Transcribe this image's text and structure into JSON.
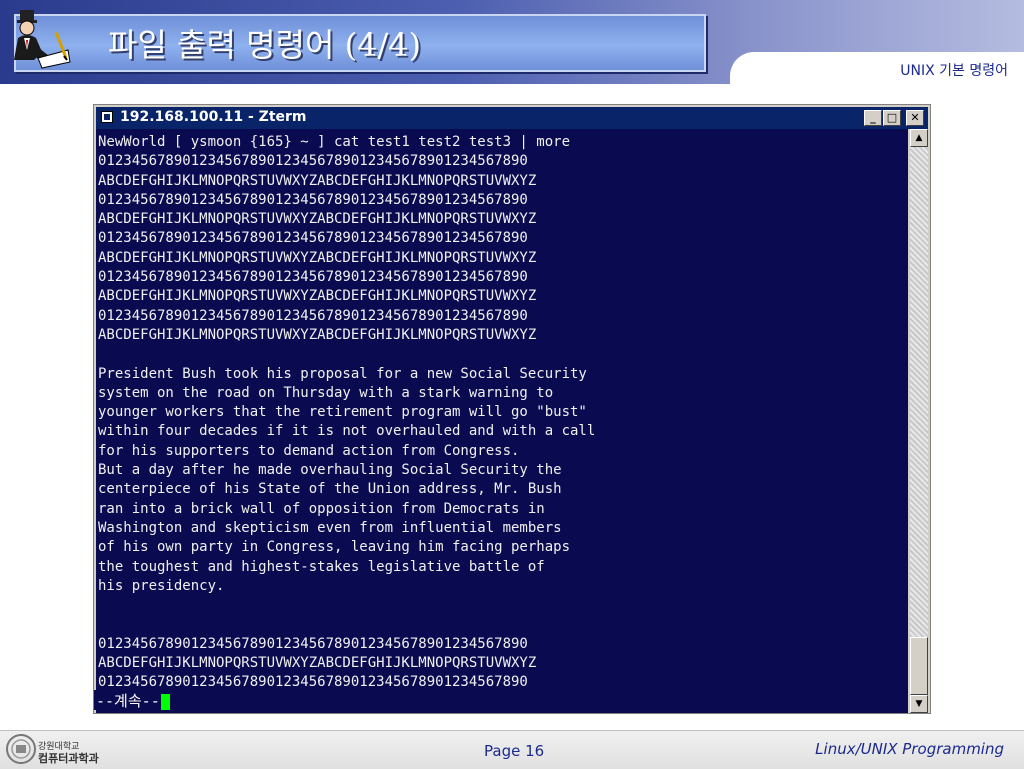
{
  "slide": {
    "title": "파일 출력 명령어 (4/4)",
    "subtitle": "UNIX 기본 명령어"
  },
  "window": {
    "title": "192.168.100.11 - Zterm",
    "minimize_label": "_",
    "maximize_label": "□",
    "close_label": "✕"
  },
  "terminal": {
    "lines": [
      "NewWorld [ ysmoon {165} ~ ] cat test1 test2 test3 | more",
      "012345678901234567890123456789012345678901234567890",
      "ABCDEFGHIJKLMNOPQRSTUVWXYZABCDEFGHIJKLMNOPQRSTUVWXYZ",
      "012345678901234567890123456789012345678901234567890",
      "ABCDEFGHIJKLMNOPQRSTUVWXYZABCDEFGHIJKLMNOPQRSTUVWXYZ",
      "012345678901234567890123456789012345678901234567890",
      "ABCDEFGHIJKLMNOPQRSTUVWXYZABCDEFGHIJKLMNOPQRSTUVWXYZ",
      "012345678901234567890123456789012345678901234567890",
      "ABCDEFGHIJKLMNOPQRSTUVWXYZABCDEFGHIJKLMNOPQRSTUVWXYZ",
      "012345678901234567890123456789012345678901234567890",
      "ABCDEFGHIJKLMNOPQRSTUVWXYZABCDEFGHIJKLMNOPQRSTUVWXYZ",
      "",
      "President Bush took his proposal for a new Social Security",
      "system on the road on Thursday with a stark warning to",
      "younger workers that the retirement program will go \"bust\"",
      "within four decades if it is not overhauled and with a call",
      "for his supporters to demand action from Congress.",
      "But a day after he made overhauling Social Security the",
      "centerpiece of his State of the Union address, Mr. Bush",
      "ran into a brick wall of opposition from Democrats in",
      "Washington and skepticism even from influential members",
      "of his own party in Congress, leaving him facing perhaps",
      "the toughest and highest-stakes legislative battle of",
      "his presidency.",
      "",
      "",
      "012345678901234567890123456789012345678901234567890",
      "ABCDEFGHIJKLMNOPQRSTUVWXYZABCDEFGHIJKLMNOPQRSTUVWXYZ",
      "012345678901234567890123456789012345678901234567890"
    ],
    "more_prompt": "--계속--"
  },
  "footer": {
    "university": "강원대학교",
    "department": "컴퓨터과학과",
    "page": "Page 16",
    "course": "Linux/UNIX Programming"
  },
  "colors": {
    "terminal_bg": "#0a0a50",
    "titlebar_bg": "#0a246a",
    "cursor": "#00ff00",
    "accent": "#1b2a8c"
  },
  "icons": {
    "logo": "person-writing-icon",
    "window": "window-icon"
  }
}
